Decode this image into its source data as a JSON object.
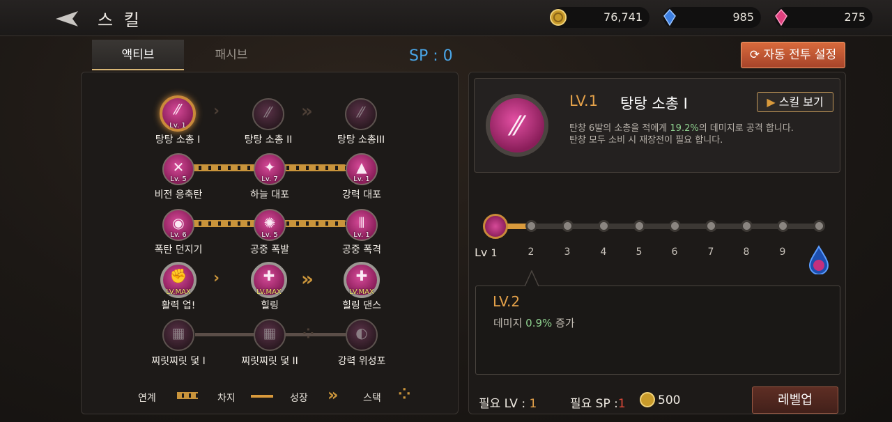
{
  "header": {
    "title": "스 킬"
  },
  "currencies": [
    {
      "icon": "gold-coin-icon",
      "value": "76,741"
    },
    {
      "icon": "blue-crystal-icon",
      "value": "985"
    },
    {
      "icon": "pink-crystal-icon",
      "value": "275"
    }
  ],
  "tabs": [
    {
      "label": "액티브",
      "active": true
    },
    {
      "label": "패시브",
      "active": false
    }
  ],
  "sp": "SP : 0",
  "auto_battle_button": "자동 전투 설정",
  "skills": [
    {
      "name": "탕탕 소총 I",
      "level": "Lv. 1"
    },
    {
      "name": "탕탕 소총 II",
      "level": ""
    },
    {
      "name": "탕탕 소총III",
      "level": ""
    },
    {
      "name": "비전 응축탄",
      "level": "Lv. 5"
    },
    {
      "name": "하늘 대포",
      "level": "Lv. 7"
    },
    {
      "name": "강력 대포",
      "level": "Lv. 1"
    },
    {
      "name": "폭탄 던지기",
      "level": "Lv. 6"
    },
    {
      "name": "공중 폭발",
      "level": "Lv. 5"
    },
    {
      "name": "공중 폭격",
      "level": "Lv. 1"
    },
    {
      "name": "활력 업!",
      "level": "LV.MAX"
    },
    {
      "name": "힐링",
      "level": "LV.MAX"
    },
    {
      "name": "힐링 댄스",
      "level": "LV.MAX"
    },
    {
      "name": "찌릿찌릿 덫 I",
      "level": ""
    },
    {
      "name": "찌릿찌릿 덫 II",
      "level": ""
    },
    {
      "name": "강력 위성포",
      "level": ""
    }
  ],
  "legend": {
    "link": "연계",
    "charge": "차지",
    "growth": "성장",
    "stack": "스택"
  },
  "detail": {
    "level": "LV.1",
    "title": "탕탕 소총 I",
    "view_button": "스킬 보기",
    "desc_pre": "탄창 6발의 소총을 적에게 ",
    "desc_pct": "19.2%",
    "desc_post": "의 데미지로 공격 합니다.",
    "desc_line2": "탄창 모두 소비 시 재장전이 필요 합니다.",
    "track_start": "Lv",
    "track_ticks": [
      "1",
      "2",
      "3",
      "4",
      "5",
      "6",
      "7",
      "8",
      "9"
    ],
    "current_progress": 1,
    "next_level": "LV.2",
    "next_desc_pre": "데미지 ",
    "next_desc_val": "0.9%",
    "next_desc_post": " 증가",
    "req_lv_label": "필요 LV :",
    "req_lv": "1",
    "req_sp_label": "필요 SP :",
    "req_sp": "1",
    "gold_cost": "500",
    "levelup_button": "레벨업"
  },
  "colors": {
    "accent_gold": "#e5a24a",
    "sp_blue": "#4aa6e8",
    "highlight_green": "#8fd18f"
  }
}
